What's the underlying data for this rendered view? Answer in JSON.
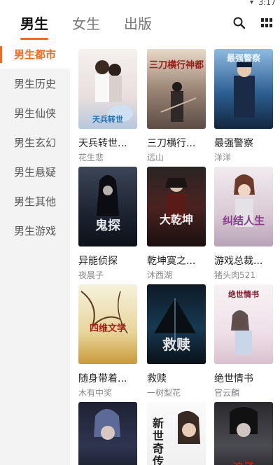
{
  "status": {
    "time": "3:17"
  },
  "tabs": [
    {
      "label": "男生"
    },
    {
      "label": "女生"
    },
    {
      "label": "出版"
    }
  ],
  "header_icons": {
    "search": "search-icon",
    "grid": "grid-icon"
  },
  "accent_color": "#f26a21",
  "sidebar": {
    "items": [
      {
        "label": "男生都市"
      },
      {
        "label": "男生历史"
      },
      {
        "label": "男生仙侠"
      },
      {
        "label": "男生玄幻"
      },
      {
        "label": "男生悬疑"
      },
      {
        "label": "男生其他"
      },
      {
        "label": "男生游戏"
      }
    ]
  },
  "books": [
    {
      "title": "天兵转世...",
      "author": "花生悲",
      "cover_text": "天兵转世"
    },
    {
      "title": "三刀横行...",
      "author": "远山",
      "cover_text": "三刀横行神都"
    },
    {
      "title": "最强警察",
      "author": "洋洋",
      "cover_text": "最强警察"
    },
    {
      "title": "异能侦探",
      "author": "夜晨子",
      "cover_text": "鬼探"
    },
    {
      "title": "乾坤寞之...",
      "author": "沐西湖",
      "cover_text": "大乾坤"
    },
    {
      "title": "游戏总裁...",
      "author": "猪头肉521",
      "cover_text": "纠结人生"
    },
    {
      "title": "随身带着...",
      "author": "木有中奖",
      "cover_text": "四维文学"
    },
    {
      "title": "救赎",
      "author": "一树梨花",
      "cover_text": "救赎"
    },
    {
      "title": "绝世情书",
      "author": "官云麟",
      "cover_text": "绝世情书"
    },
    {
      "title": "",
      "author": "",
      "cover_text": ""
    },
    {
      "title": "",
      "author": "",
      "cover_text": "新世奇传"
    },
    {
      "title": "",
      "author": "",
      "cover_text": "浪子"
    }
  ]
}
